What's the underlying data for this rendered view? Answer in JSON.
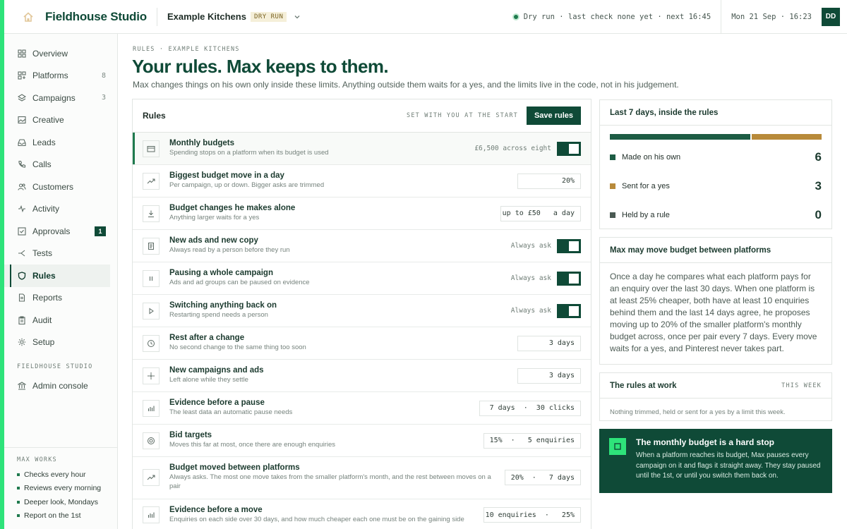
{
  "topbar": {
    "brand": "Fieldhouse Studio",
    "client": "Example Kitchens",
    "mode_badge": "DRY RUN",
    "status": "Dry run · last check none yet · next 16:45",
    "clock": "Mon 21 Sep · 16:23",
    "avatar": "DD"
  },
  "sidebar": {
    "items": [
      {
        "label": "Overview",
        "icon": "grid-icon"
      },
      {
        "label": "Platforms",
        "icon": "platforms-icon",
        "count": "8"
      },
      {
        "label": "Campaigns",
        "icon": "layers-icon",
        "count": "3"
      },
      {
        "label": "Creative",
        "icon": "image-icon"
      },
      {
        "label": "Leads",
        "icon": "inbox-icon"
      },
      {
        "label": "Calls",
        "icon": "phone-icon"
      },
      {
        "label": "Customers",
        "icon": "users-icon"
      },
      {
        "label": "Activity",
        "icon": "pulse-icon"
      },
      {
        "label": "Approvals",
        "icon": "check-square-icon",
        "badge": "1"
      },
      {
        "label": "Tests",
        "icon": "split-icon"
      },
      {
        "label": "Rules",
        "icon": "shield-icon",
        "active": true
      },
      {
        "label": "Reports",
        "icon": "document-icon"
      },
      {
        "label": "Audit",
        "icon": "clipboard-icon"
      },
      {
        "label": "Setup",
        "icon": "gear-icon"
      }
    ],
    "section_label": "FIELDHOUSE STUDIO",
    "admin_label": "Admin console",
    "works_title": "MAX WORKS",
    "works": [
      "Checks every hour",
      "Reviews every morning",
      "Deeper look, Mondays",
      "Report on the 1st"
    ]
  },
  "header": {
    "crumb": "RULES · EXAMPLE KITCHENS",
    "title": "Your rules. Max keeps to them.",
    "subtitle": "Max changes things on his own only inside these limits. Anything outside them waits for a yes, and the limits live in the code, not in his judgement."
  },
  "rules": {
    "title": "Rules",
    "caption": "SET WITH YOU AT THE START",
    "save_label": "Save rules",
    "rows": [
      {
        "name": "Monthly budgets",
        "desc": "Spending stops on a platform when its budget is used",
        "note": "£6,500 across eight",
        "toggle_on": true,
        "icon": "wallet-icon"
      },
      {
        "name": "Biggest budget move in a day",
        "desc": "Per campaign, up or down. Bigger asks are trimmed",
        "value": "20%",
        "icon": "trend-icon"
      },
      {
        "name": "Budget changes he makes alone",
        "desc": "Anything larger waits for a yes",
        "value": "up to £50   a day",
        "icon": "download-icon"
      },
      {
        "name": "New ads and new copy",
        "desc": "Always read by a person before they run",
        "note": "Always ask",
        "toggle_on": true,
        "icon": "page-icon"
      },
      {
        "name": "Pausing a whole campaign",
        "desc": "Ads and ad groups can be paused on evidence",
        "note": "Always ask",
        "toggle_on": true,
        "icon": "pause-icon"
      },
      {
        "name": "Switching anything back on",
        "desc": "Restarting spend needs a person",
        "note": "Always ask",
        "toggle_on": true,
        "icon": "play-icon"
      },
      {
        "name": "Rest after a change",
        "desc": "No second change to the same thing too soon",
        "value": "3 days",
        "icon": "clock-icon"
      },
      {
        "name": "New campaigns and ads",
        "desc": "Left alone while they settle",
        "value": "3 days",
        "icon": "sparkle-icon"
      },
      {
        "name": "Evidence before a pause",
        "desc": "The least data an automatic pause needs",
        "value": "7 days  ·  30 clicks",
        "icon": "bars-icon"
      },
      {
        "name": "Bid targets",
        "desc": "Moves this far at most, once there are enough enquiries",
        "value": "15%  ·   5 enquiries",
        "icon": "target-icon"
      },
      {
        "name": "Budget moved between platforms",
        "desc": "Always asks. The most one move takes from the smaller platform's month, and the rest between moves on a pair",
        "value": "20%  ·   7 days",
        "icon": "trend-icon",
        "tall": true
      },
      {
        "name": "Evidence before a move",
        "desc": "Enquiries on each side over 30 days, and how much cheaper each one must be on the gaining side",
        "value": "10 enquiries  ·   25%",
        "icon": "bars-icon"
      }
    ]
  },
  "summary": {
    "title": "Last 7 days, inside the rules",
    "stats": [
      {
        "label": "Made on his own",
        "value": 6,
        "color": "#1d5c44"
      },
      {
        "label": "Sent for a yes",
        "value": 3,
        "color": "#b88a3a"
      },
      {
        "label": "Held by a rule",
        "value": 0,
        "color": "#4a5a53"
      }
    ]
  },
  "budget_card": {
    "title": "Max may move budget between platforms",
    "body": "Once a day he compares what each platform pays for an enquiry over the last 30 days. When one platform is at least 25% cheaper, both have at least 10 enquiries behind them and the last 14 days agree, he proposes moving up to 20% of the smaller platform's monthly budget across, once per pair every 7 days. Every move waits for a yes, and Pinterest never takes part."
  },
  "work_card": {
    "title": "The rules at work",
    "tag": "THIS WEEK",
    "note": "Nothing trimmed, held or sent for a yes by a limit this week."
  },
  "stop_card": {
    "title": "The monthly budget is a hard stop",
    "text": "When a platform reaches its budget, Max pauses every campaign on it and flags it straight away. They stay paused until the 1st, or until you switch them back on."
  }
}
